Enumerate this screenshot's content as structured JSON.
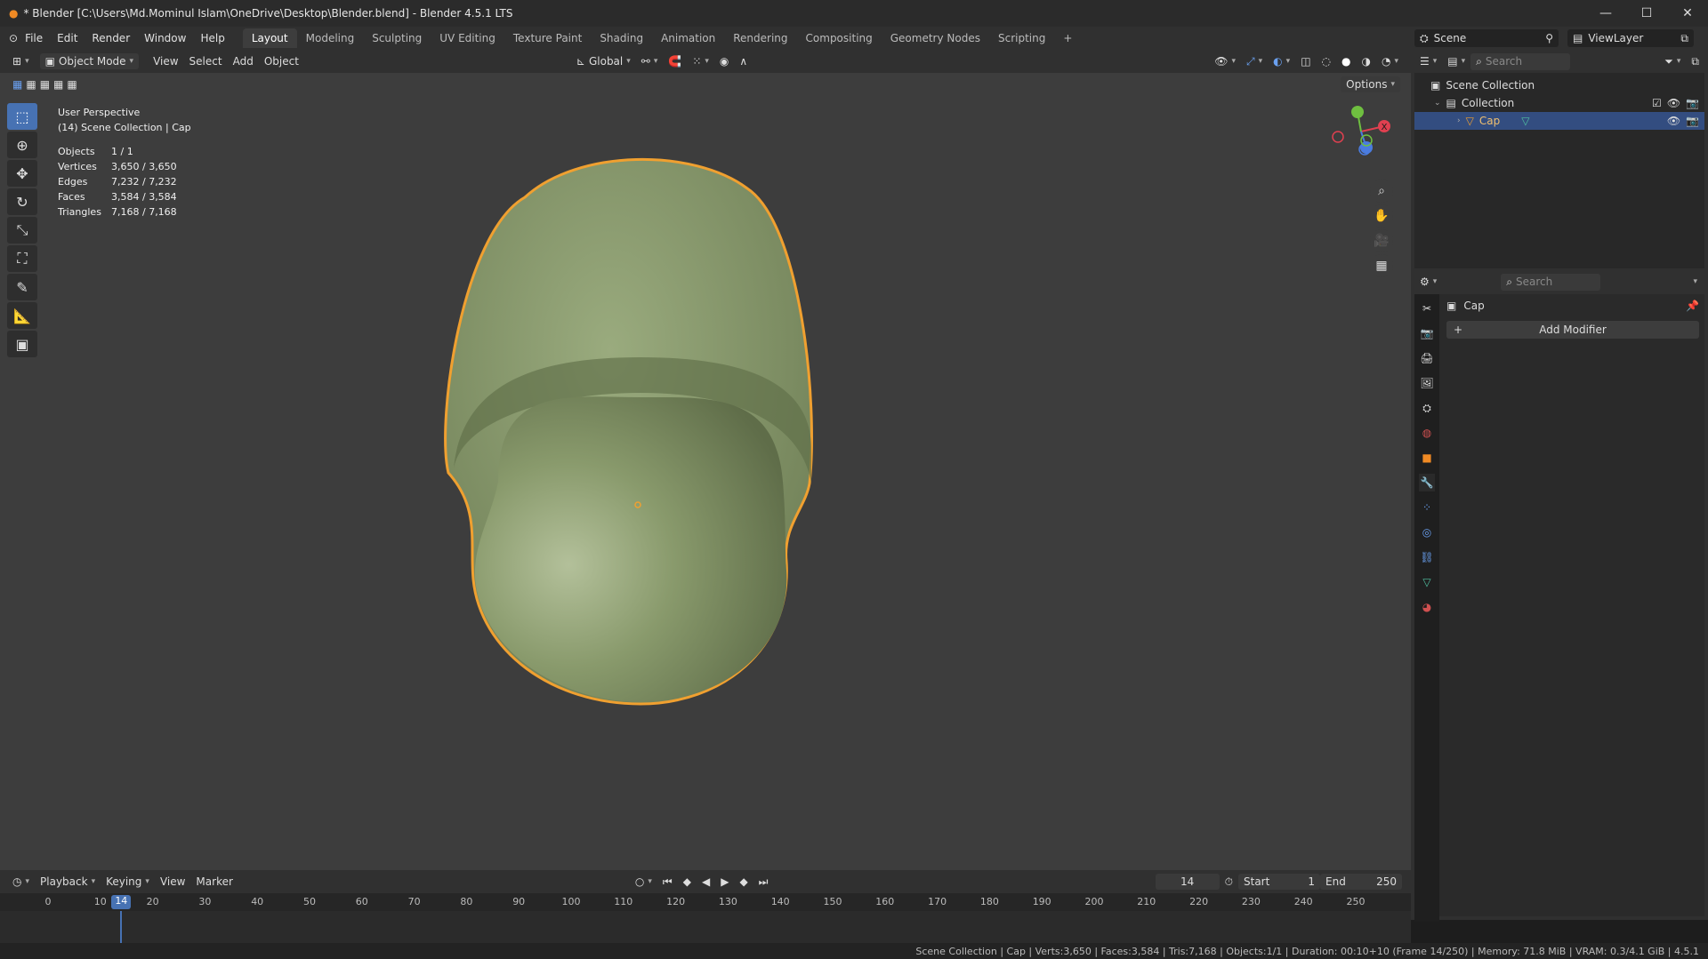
{
  "window": {
    "title": "* Blender [C:\\Users\\Md.Mominul Islam\\OneDrive\\Desktop\\Blender.blend] - Blender 4.5.1 LTS",
    "minimize": "—",
    "maximize": "☐",
    "close": "✕"
  },
  "menu": [
    "File",
    "Edit",
    "Render",
    "Window",
    "Help"
  ],
  "workspaces": [
    {
      "label": "Layout",
      "active": true
    },
    {
      "label": "Modeling"
    },
    {
      "label": "Sculpting"
    },
    {
      "label": "UV Editing"
    },
    {
      "label": "Texture Paint"
    },
    {
      "label": "Shading"
    },
    {
      "label": "Animation"
    },
    {
      "label": "Rendering"
    },
    {
      "label": "Compositing"
    },
    {
      "label": "Geometry Nodes"
    },
    {
      "label": "Scripting"
    }
  ],
  "scene": {
    "label": "Scene",
    "view_layer": "ViewLayer"
  },
  "viewport_header": {
    "mode": "Object Mode",
    "menus": [
      "View",
      "Select",
      "Add",
      "Object"
    ],
    "transform_orientation": "Global",
    "options": "Options"
  },
  "viewport_overlay": {
    "perspective": "User Perspective",
    "context": "(14) Scene Collection | Cap",
    "stats": [
      {
        "label": "Objects",
        "value": "1 / 1"
      },
      {
        "label": "Vertices",
        "value": "3,650 / 3,650"
      },
      {
        "label": "Edges",
        "value": "7,232 / 7,232"
      },
      {
        "label": "Faces",
        "value": "3,584 / 3,584"
      },
      {
        "label": "Triangles",
        "value": "7,168 / 7,168"
      }
    ]
  },
  "gizmo": {
    "x": "X",
    "colors": {
      "x": "#e04050",
      "y": "#6fbf40",
      "z": "#4a7ce0"
    }
  },
  "outliner": {
    "search_placeholder": "Search",
    "scene_collection": "Scene Collection",
    "collection": "Collection",
    "object": "Cap"
  },
  "properties": {
    "search_placeholder": "Search",
    "object_name": "Cap",
    "add_modifier": "Add Modifier"
  },
  "timeline": {
    "menus": [
      "Playback",
      "Keying",
      "View",
      "Marker"
    ],
    "current_frame": "14",
    "start_label": "Start",
    "start": "1",
    "end_label": "End",
    "end": "250",
    "ticks": [
      "0",
      "10",
      "20",
      "30",
      "40",
      "50",
      "60",
      "70",
      "80",
      "90",
      "100",
      "110",
      "120",
      "130",
      "140",
      "150",
      "160",
      "170",
      "180",
      "190",
      "200",
      "210",
      "220",
      "230",
      "240",
      "250"
    ],
    "playhead": "14"
  },
  "statusbar": {
    "text": "Scene Collection | Cap | Verts:3,650 | Faces:3,584 | Tris:7,168 | Objects:1/1 | Duration: 00:10+10 (Frame 14/250) | Memory: 71.8 MiB | VRAM: 0.3/4.1 GiB | 4.5.1"
  },
  "colors": {
    "accent": "#4772b3",
    "selection_outline": "#f0a030",
    "mesh": "#8a9a6e"
  }
}
